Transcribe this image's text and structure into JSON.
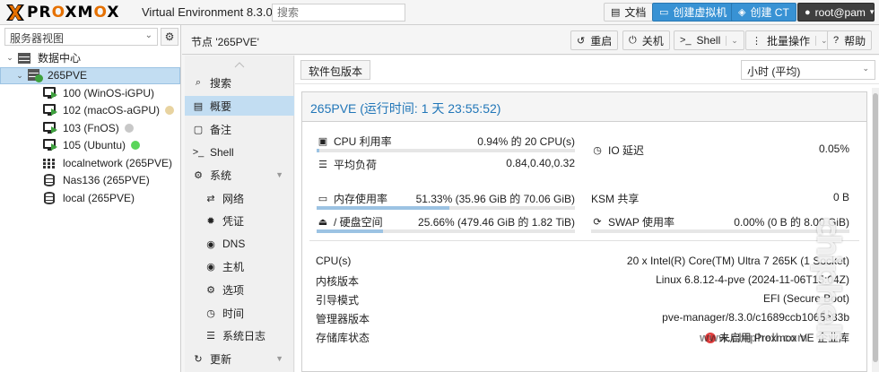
{
  "app": {
    "logo_text_a": "PR",
    "logo_text_o": "O",
    "logo_text_b": "XM",
    "logo_text_o2": "O",
    "logo_text_c": "X",
    "version": "Virtual Environment 8.3.0",
    "search_placeholder": "搜索",
    "docs_label": "文档",
    "create_vm_label": "创建虚拟机",
    "create_ct_label": "创建 CT",
    "user_label": "root@pam",
    "accent_color": "#3892d4",
    "logo_color": "#e57000"
  },
  "sidebar": {
    "view_label": "服务器视图",
    "tree": [
      {
        "label": "数据中心",
        "icon": "datacenter-icon",
        "level": 0
      },
      {
        "label": "265PVE",
        "icon": "node-icon",
        "level": 1,
        "selected": true
      },
      {
        "label": "100 (WinOS-iGPU)",
        "icon": "vm-running-icon",
        "level": 2
      },
      {
        "label": "102 (macOS-aGPU)",
        "icon": "vm-running-icon",
        "level": 2,
        "tag_color": "#e8d3a0"
      },
      {
        "label": "103 (FnOS)",
        "icon": "vm-running-icon",
        "level": 2,
        "tag_color": "#c8c8c8"
      },
      {
        "label": "105 (Ubuntu)",
        "icon": "vm-running-icon",
        "level": 2,
        "tag_color": "#5ad55a"
      },
      {
        "label": "localnetwork (265PVE)",
        "icon": "network-icon",
        "level": 2
      },
      {
        "label": "Nas136 (265PVE)",
        "icon": "storage-icon",
        "level": 2
      },
      {
        "label": "local (265PVE)",
        "icon": "storage-icon",
        "level": 2
      }
    ]
  },
  "header": {
    "title": "节点 '265PVE'",
    "reboot_label": "重启",
    "shutdown_label": "关机",
    "shell_label": "Shell",
    "bulk_label": "批量操作",
    "help_label": "帮助"
  },
  "menu": {
    "items": [
      {
        "label": "搜索",
        "icon": "search-icon"
      },
      {
        "label": "概要",
        "icon": "book-icon",
        "selected": true
      },
      {
        "label": "备注",
        "icon": "note-icon"
      },
      {
        "label": "Shell",
        "icon": "terminal-icon"
      },
      {
        "label": "系统",
        "icon": "gears-icon",
        "expandable": true
      },
      {
        "label": "网络",
        "icon": "exchange-icon",
        "sub": true
      },
      {
        "label": "凭证",
        "icon": "certificate-icon",
        "sub": true
      },
      {
        "label": "DNS",
        "icon": "globe-icon",
        "sub": true
      },
      {
        "label": "主机",
        "icon": "globe-icon",
        "sub": true
      },
      {
        "label": "选项",
        "icon": "gear-icon",
        "sub": true
      },
      {
        "label": "时间",
        "icon": "clock-icon",
        "sub": true
      },
      {
        "label": "系统日志",
        "icon": "list-icon",
        "sub": true
      },
      {
        "label": "更新",
        "icon": "refresh-icon",
        "expandable": true
      }
    ]
  },
  "main": {
    "pkg_versions_label": "软件包版本",
    "time_range": "小时 (平均)",
    "panel_title": "265PVE (运行时间: 1 天 23:55:52)",
    "cpu_label": "CPU 利用率",
    "cpu_value": "0.94% 的 20 CPU(s)",
    "cpu_fraction": 0.0094,
    "io_label": "IO 延迟",
    "io_value": "0.05%",
    "load_label": "平均负荷",
    "load_value": "0.84,0.40,0.32",
    "mem_label": "内存使用率",
    "mem_value": "51.33% (35.96 GiB 的 70.06 GiB)",
    "mem_fraction": 0.5133,
    "ksm_label": "KSM 共享",
    "ksm_value": "0 B",
    "disk_label": "/ 硬盘空间",
    "disk_value": "25.66% (479.46 GiB 的 1.82 TiB)",
    "disk_fraction": 0.2566,
    "swap_label": "SWAP 使用率",
    "swap_value": "0.00% (0 B 的 8.00 GiB)",
    "swap_fraction": 0.0,
    "info": [
      {
        "label": "CPU(s)",
        "value": "20 x Intel(R) Core(TM) Ultra 7 265K (1 Socket)"
      },
      {
        "label": "内核版本",
        "value": "Linux 6.8.12-4-pve (2024-11-06T15:04Z)"
      },
      {
        "label": "引导模式",
        "value": "EFI (Secure Boot)"
      },
      {
        "label": "管理器版本",
        "value": "pve-manager/8.3.0/c1689ccb1065a83b"
      },
      {
        "label": "存储库状态",
        "value": "未启用 Proxmox VE 企业库"
      }
    ]
  },
  "watermark": {
    "site": "chiphell",
    "url": "www.chiphell.com"
  }
}
